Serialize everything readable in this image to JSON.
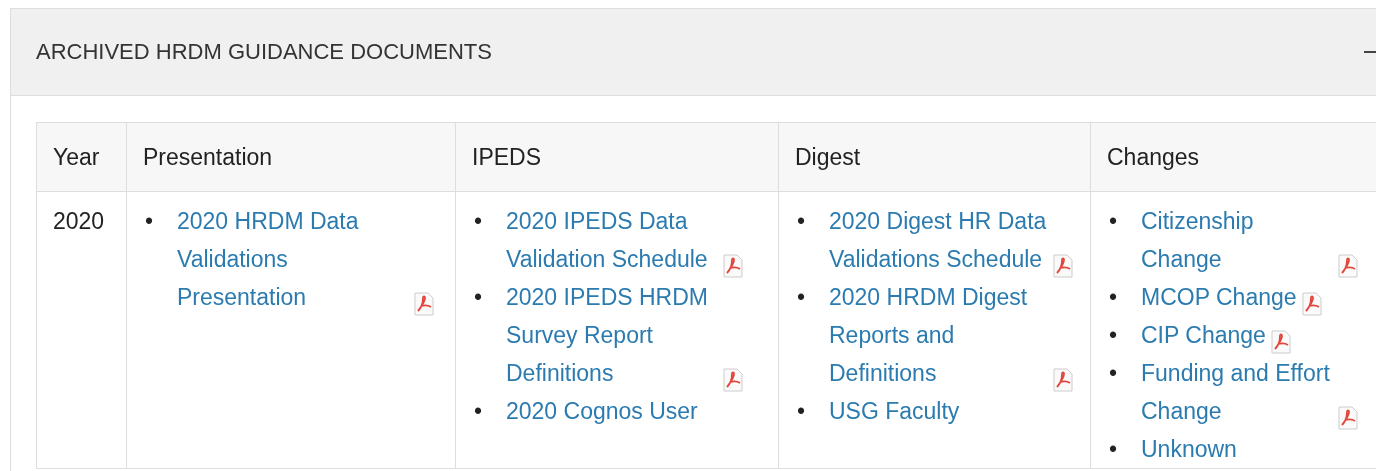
{
  "panel": {
    "title": "ARCHIVED HRDM GUIDANCE DOCUMENTS",
    "expanded": true
  },
  "table": {
    "columns": [
      "Year",
      "Presentation",
      "IPEDS",
      "Digest",
      "Changes"
    ],
    "rows": [
      {
        "cells": [
          {
            "kind": "text",
            "text": "2020"
          },
          {
            "kind": "list",
            "items": [
              {
                "marker": "•",
                "text": "2020 HRDM Data Validations Presentation",
                "pdf": true
              }
            ]
          },
          {
            "kind": "list",
            "items": [
              {
                "marker": "•",
                "text": "2020 IPEDS Data Validation Schedule",
                "pdf": true
              },
              {
                "marker": "•",
                "text": "2020 IPEDS HRDM Survey Report Definitions",
                "pdf": true
              },
              {
                "marker": "•",
                "text": "2020 Cognos User",
                "pdf": false
              }
            ]
          },
          {
            "kind": "list",
            "items": [
              {
                "marker": "•",
                "text": "2020 Digest HR Data Validations Schedule",
                "pdf": true
              },
              {
                "marker": "•",
                "text": "2020 HRDM Digest Reports and Definitions",
                "pdf": true
              },
              {
                "marker": "•",
                "text": "USG Faculty",
                "pdf": false
              }
            ]
          },
          {
            "kind": "list",
            "items": [
              {
                "marker": "•",
                "text": "Citizenship Change",
                "pdf": true
              },
              {
                "marker": "•",
                "text": "MCOP Change",
                "pdf": true
              },
              {
                "marker": "•",
                "text": "CIP Change",
                "pdf": true
              },
              {
                "marker": "•",
                "text": "Funding and Effort Change",
                "pdf": true
              },
              {
                "marker": "•",
                "text": "Unknown",
                "pdf": false
              }
            ]
          }
        ]
      }
    ]
  }
}
